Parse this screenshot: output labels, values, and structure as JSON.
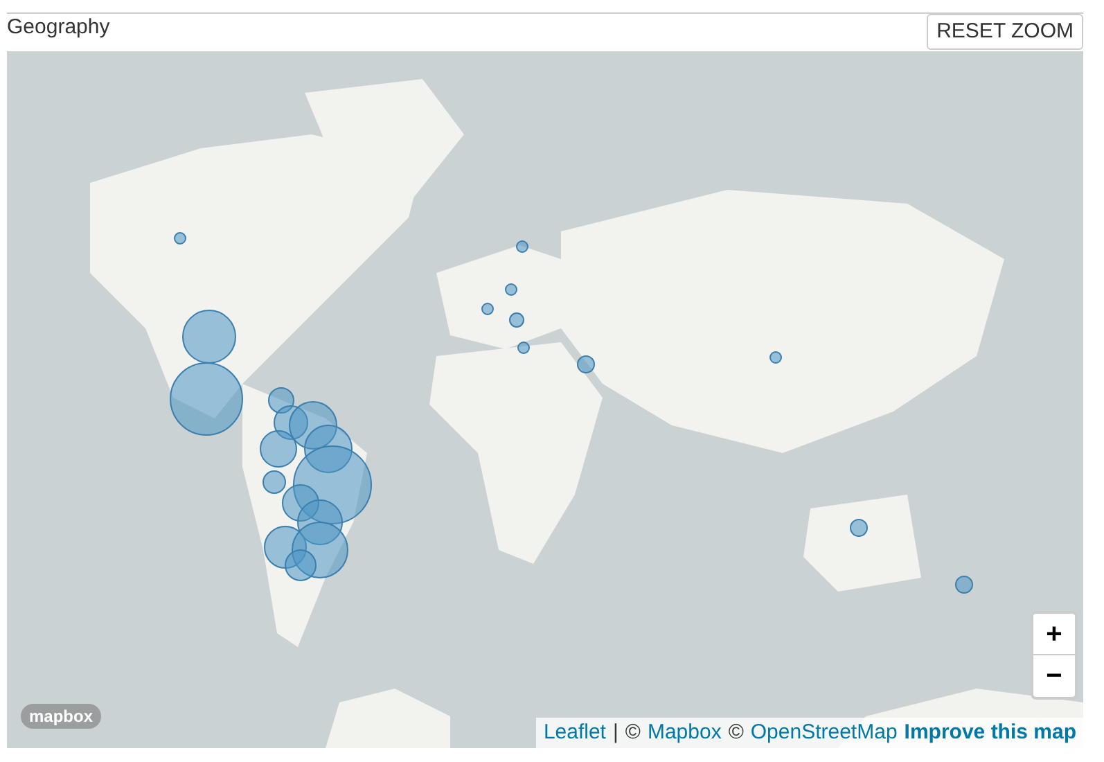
{
  "panel": {
    "title": "Geography",
    "reset_button": "RESET ZOOM"
  },
  "map": {
    "logo": "mapbox",
    "zoom_in": "+",
    "zoom_out": "−",
    "attribution": [
      {
        "kind": "link",
        "text": "Leaflet"
      },
      {
        "kind": "plain",
        "text": "|"
      },
      {
        "kind": "plain",
        "text": "©"
      },
      {
        "kind": "link",
        "text": "Mapbox"
      },
      {
        "kind": "plain",
        "text": "©"
      },
      {
        "kind": "link",
        "text": "OpenStreetMap"
      },
      {
        "kind": "strong-link",
        "text": "Improve this map"
      }
    ]
  }
}
